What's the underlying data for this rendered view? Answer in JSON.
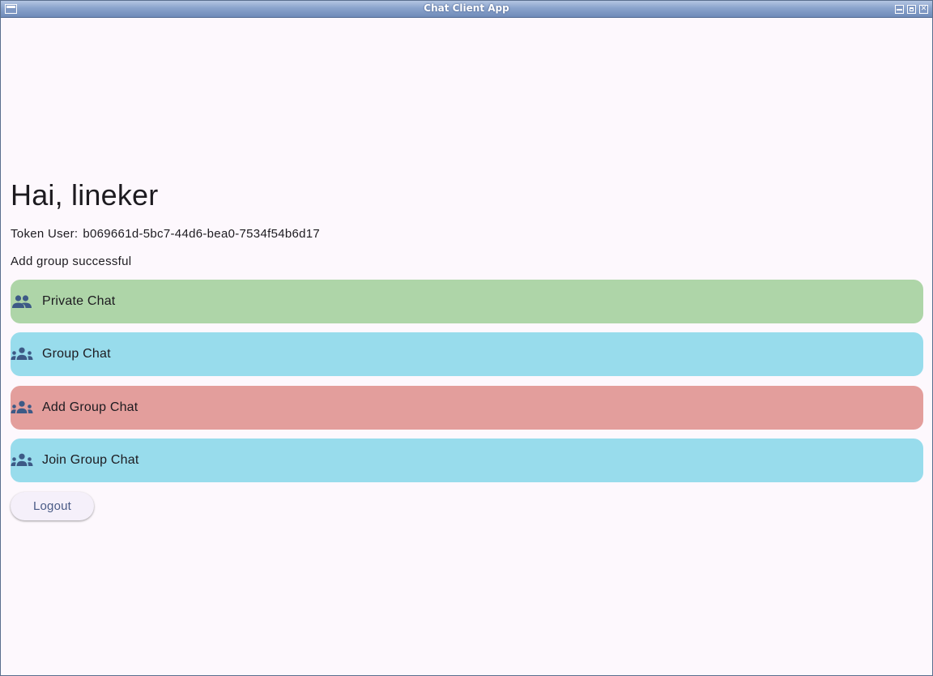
{
  "window": {
    "title": "Chat Client App"
  },
  "greeting": "Hai, lineker",
  "token": {
    "label": "Token User:",
    "value": "b069661d-5bc7-44d6-bea0-7534f54b6d17"
  },
  "status_message": "Add group successful",
  "actions": [
    {
      "label": "Private Chat",
      "icon": "people-icon",
      "color": "#aed5a8"
    },
    {
      "label": "Group Chat",
      "icon": "groups-icon",
      "color": "#98dcec"
    },
    {
      "label": "Add Group Chat",
      "icon": "groups-icon",
      "color": "#e39e9c"
    },
    {
      "label": "Join Group Chat",
      "icon": "groups-icon",
      "color": "#98dcec"
    }
  ],
  "logout_label": "Logout",
  "colors": {
    "icon": "#3d5a86",
    "background": "#fdf8fd"
  }
}
